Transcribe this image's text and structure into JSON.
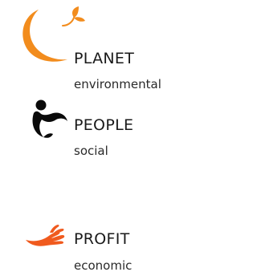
{
  "colors": {
    "accent_orange": "#f28c1d",
    "profit_orange": "#f05a1e",
    "people_black": "#0a0a0a",
    "text": "#1a1a1a"
  },
  "items": [
    {
      "icon": "orange-crescent-sprout-icon",
      "title": "PLANET",
      "subtitle": "environmental"
    },
    {
      "icon": "person-figure-icon",
      "title": "PEOPLE",
      "subtitle": "social"
    },
    {
      "icon": "hand-icon",
      "title": "PROFIT",
      "subtitle": "economic"
    }
  ]
}
